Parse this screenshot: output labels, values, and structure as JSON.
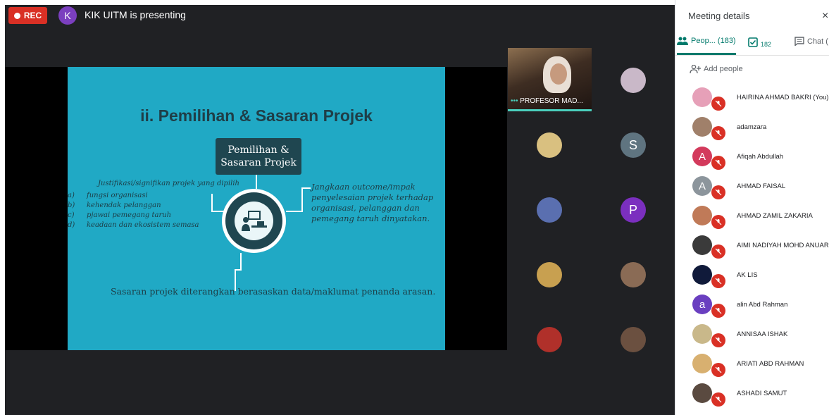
{
  "topbar": {
    "rec_label": "REC",
    "presenter_initial": "K",
    "presenting_text": "KIK UITM is presenting"
  },
  "slide": {
    "title": "ii. Pemilihan & Sasaran Projek",
    "box_line1": "Pemilihan &",
    "box_line2": "Sasaran Projek",
    "left_heading": "Justifikasi/signifikan projek yang dipilih",
    "left_items": [
      {
        "letter": "a)",
        "text": "fungsi organisasi"
      },
      {
        "letter": "b)",
        "text": "kehendak pelanggan"
      },
      {
        "letter": "c)",
        "text": "pjawai pemegang taruh"
      },
      {
        "letter": "d)",
        "text": "keadaan dan ekosistem semasa"
      }
    ],
    "right_text": "Jangkaan outcome/impak penyelesaian projek terhadap organisasi, pelanggan dan pemegang taruh dinyatakan.",
    "bottom_text": "Sasaran projek diterangkan berasaskan data/maklumat penanda arasan."
  },
  "grid": {
    "self_label": "PROFESOR MAD...",
    "tiles": [
      {
        "initial": "",
        "color": "#c9b8c8"
      },
      {
        "initial": "",
        "color": "#d9c080"
      },
      {
        "initial": "S",
        "color": "#5f7480"
      },
      {
        "initial": "",
        "color": "#5a6fb0"
      },
      {
        "initial": "P",
        "color": "#7b2fbf"
      },
      {
        "initial": "",
        "color": "#c8a050"
      },
      {
        "initial": "",
        "color": "#8a6b55"
      },
      {
        "initial": "",
        "color": "#b0302a"
      },
      {
        "initial": "",
        "color": "#6b5040"
      }
    ]
  },
  "panel": {
    "title": "Meeting details",
    "close_icon": "close-icon",
    "tab_people": "Peop... (183)",
    "tab_check_count": "182",
    "tab_chat": "Chat (",
    "add_people": "Add people",
    "people": [
      {
        "name": "HAIRINA AHMAD BAKRI (You)",
        "initial": "",
        "color": "#e6a0b8"
      },
      {
        "name": "adamzara",
        "initial": "",
        "color": "#a0806a"
      },
      {
        "name": "Afiqah Abdullah",
        "initial": "A",
        "color": "#d33a5c"
      },
      {
        "name": "AHMAD FAISAL",
        "initial": "A",
        "color": "#8c959c"
      },
      {
        "name": "AHMAD ZAMIL ZAKARIA",
        "initial": "",
        "color": "#c07a58"
      },
      {
        "name": "AIMI NADIYAH MOHD ANUAR",
        "initial": "",
        "color": "#3a3a3a"
      },
      {
        "name": "AK LIS",
        "initial": "",
        "color": "#101a3a"
      },
      {
        "name": "alin Abd Rahman",
        "initial": "a",
        "color": "#6a3fc0"
      },
      {
        "name": "ANNISAA ISHAK",
        "initial": "",
        "color": "#c9b88a"
      },
      {
        "name": "ARIATI ABD RAHMAN",
        "initial": "",
        "color": "#d8b070"
      },
      {
        "name": "ASHADI SAMUT",
        "initial": "",
        "color": "#5a4a40"
      }
    ]
  }
}
